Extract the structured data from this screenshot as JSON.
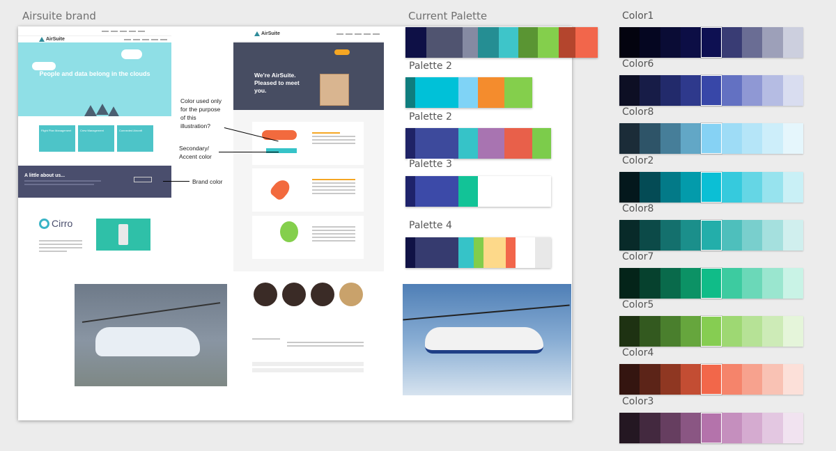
{
  "titles": {
    "brand": "Airsuite brand",
    "current_palette": "Current Palette",
    "palette_2a": "Palette 2",
    "palette_2b": "Palette 2",
    "palette_3": "Palette 3",
    "palette_4": "Palette 4"
  },
  "board": {
    "logo": "AirSuite",
    "logo2": "AirSuite",
    "hero1": "People and data belong in the clouds",
    "hero2_line1": "We're AirSuite.",
    "hero2_line2": "Pleased to meet",
    "hero2_line3": "you.",
    "about": "A little about us...",
    "cirro": "Cirro",
    "card1": "Flight Plan Management",
    "card2": "Crew Management",
    "card3": "Connected Aircraft"
  },
  "annotations": {
    "illustration_1": "Color used only",
    "illustration_2": "for the purpose",
    "illustration_3": "of this",
    "illustration_4": "illustration?",
    "accent_1": "Secondary/",
    "accent_2": "Accent color",
    "brand": "Brand color"
  },
  "palettes": {
    "current": [
      "#0e1046",
      "#505470",
      "#858aa2",
      "#258e93",
      "#3ec5c9",
      "#5a9533",
      "#84cf4c",
      "#b4452d",
      "#f2664b"
    ],
    "palette_2a": [
      "#0f7d7e",
      "#00c1d8",
      "#7fd3f6",
      "#f48c2d",
      "#84cf4c"
    ],
    "palette_2b": [
      "#1f2366",
      "#3d4a9c",
      "#36c3c8",
      "#a874b1",
      "#e8604a",
      "#7ccc4b"
    ],
    "palette_3": [
      "#1e236b",
      "#3c4aa8",
      "#12c397",
      "#ffffff"
    ],
    "palette_4": [
      "#101245",
      "#363b6f",
      "#36c3c8",
      "#82cd4b",
      "#fdd98a",
      "#f2664b",
      "#ffffff",
      "#e8e8e8"
    ]
  },
  "ramps": [
    {
      "name": "Color1",
      "colors": [
        "#03030f",
        "#050621",
        "#0a0c35",
        "#0c0e45",
        "#0e1052",
        "#393c74",
        "#6a6d94",
        "#9da0b9",
        "#cccfde"
      ],
      "selected": 4
    },
    {
      "name": "Color6",
      "colors": [
        "#0d0f24",
        "#171c47",
        "#222a6b",
        "#2e398c",
        "#3847a8",
        "#6371c2",
        "#8f98d4",
        "#b5bce3",
        "#d9ddf0"
      ],
      "selected": 4
    },
    {
      "name": "Color8",
      "colors": [
        "#1b2c38",
        "#2e5468",
        "#467e99",
        "#62a7c6",
        "#86d2f4",
        "#9edcf6",
        "#b5e5f8",
        "#cdeefa",
        "#e5f6fc"
      ],
      "selected": 4
    },
    {
      "name": "Color2",
      "colors": [
        "#04181c",
        "#044b55",
        "#037a88",
        "#039bab",
        "#0bbfd5",
        "#36cadd",
        "#65d6e5",
        "#97e3ee",
        "#c9f0f6"
      ],
      "selected": 4
    },
    {
      "name": "Color8",
      "colors": [
        "#082a29",
        "#0c4a48",
        "#14706d",
        "#1b8f8b",
        "#23aeaa",
        "#4ebfbc",
        "#79cfcd",
        "#a5e0de",
        "#d0efee"
      ],
      "selected": 4
    },
    {
      "name": "Color7",
      "colors": [
        "#042419",
        "#06412e",
        "#096a4b",
        "#0c9265",
        "#10bc88",
        "#3dcba0",
        "#6bd8b8",
        "#9ae6cf",
        "#c9f3e6"
      ],
      "selected": 4
    },
    {
      "name": "Color5",
      "colors": [
        "#1e3212",
        "#33591f",
        "#4a7f2d",
        "#66a63d",
        "#86cd52",
        "#9ed873",
        "#b6e296",
        "#cdebb7",
        "#e5f5da"
      ],
      "selected": 4
    },
    {
      "name": "Color4",
      "colors": [
        "#341510",
        "#5c2418",
        "#8f3722",
        "#c34d33",
        "#f2674a",
        "#f5846b",
        "#f7a28e",
        "#f9c2b4",
        "#fce0d9"
      ],
      "selected": 4
    },
    {
      "name": "Color3",
      "colors": [
        "#241722",
        "#43293f",
        "#663e60",
        "#8a5683",
        "#b473ab",
        "#c58fbe",
        "#d5abd0",
        "#e3c7e1",
        "#f1e3f0"
      ],
      "selected": 4
    }
  ]
}
